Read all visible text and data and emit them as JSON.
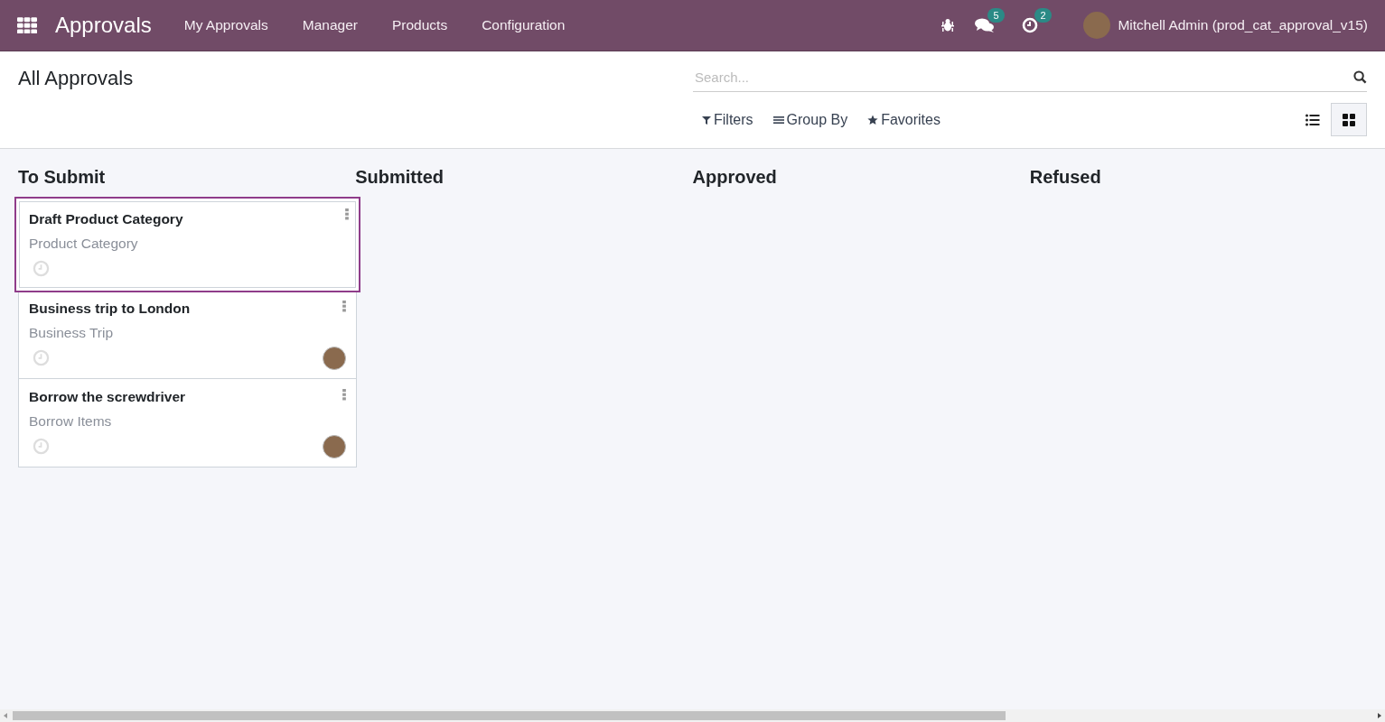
{
  "navbar": {
    "app_name": "Approvals",
    "menu": [
      "My Approvals",
      "Manager",
      "Products",
      "Configuration"
    ],
    "messages_count": "5",
    "activities_count": "2",
    "user": "Mitchell Admin (prod_cat_approval_v15)"
  },
  "control_panel": {
    "title": "All Approvals",
    "search": {
      "placeholder": "Search..."
    },
    "filters": [
      "Filters",
      "Group By",
      "Favorites"
    ],
    "views": [
      {
        "kind": "list",
        "selected": false
      },
      {
        "kind": "kanban",
        "selected": true
      }
    ]
  },
  "columns": [
    {
      "title": "To Submit",
      "cards": [
        {
          "title": "Draft Product Category",
          "category": "Product Category",
          "selected": true,
          "has_avatar": false
        },
        {
          "title": "Business trip to London",
          "category": "Business Trip",
          "selected": false,
          "has_avatar": true
        },
        {
          "title": "Borrow the screwdriver",
          "category": "Borrow Items",
          "selected": false,
          "has_avatar": true
        }
      ]
    },
    {
      "title": "Submitted"
    },
    {
      "title": "Approved"
    },
    {
      "title": "Refused"
    }
  ]
}
